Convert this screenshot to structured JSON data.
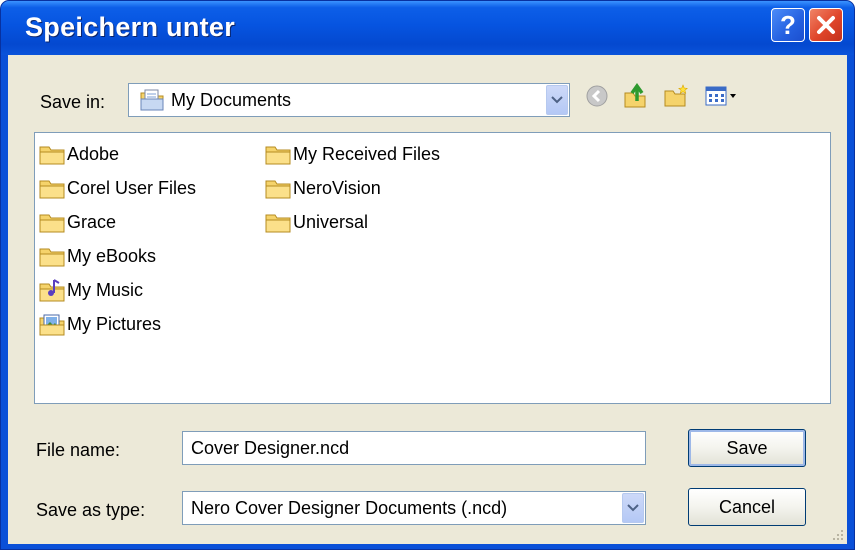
{
  "window": {
    "title": "Speichern unter",
    "help_label": "?",
    "close_label": "✕"
  },
  "toolbar": {
    "save_in_label": "Save in:",
    "location": "My Documents",
    "icons": [
      "back-icon",
      "up-folder-icon",
      "new-folder-icon",
      "view-menu-icon"
    ]
  },
  "files": {
    "column1": [
      {
        "name": "Adobe",
        "icon": "folder-icon"
      },
      {
        "name": "Corel User Files",
        "icon": "folder-icon"
      },
      {
        "name": "Grace",
        "icon": "folder-icon"
      },
      {
        "name": "My eBooks",
        "icon": "folder-icon"
      },
      {
        "name": "My Music",
        "icon": "music-folder-icon"
      },
      {
        "name": "My Pictures",
        "icon": "pictures-folder-icon"
      }
    ],
    "column2": [
      {
        "name": "My Received Files",
        "icon": "folder-icon"
      },
      {
        "name": "NeroVision",
        "icon": "folder-icon"
      },
      {
        "name": "Universal",
        "icon": "folder-icon"
      }
    ]
  },
  "form": {
    "file_name_label": "File name:",
    "file_name_value": "Cover Designer.ncd",
    "type_label": "Save as type:",
    "type_value": "Nero Cover Designer Documents (.ncd)",
    "save_label": "Save",
    "cancel_label": "Cancel"
  },
  "colors": {
    "titlebar": "#0654e0",
    "dialog_bg": "#ece9d8",
    "close_button": "#e0452a",
    "folder": "#f5d36b"
  }
}
